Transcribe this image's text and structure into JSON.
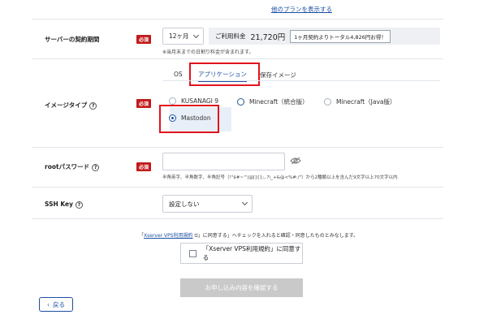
{
  "header": {
    "other_plans_link": "他のプランを表示する"
  },
  "contract": {
    "label": "サーバーの契約期間",
    "required": "必須",
    "period_value": "12ヶ月",
    "fee_label": "ご利用料金",
    "fee_value": "21,720円",
    "fee_note": "1ヶ月契約よりトータル4,826円お得！",
    "footnote": "※当月末までの日割り料金が含まれます。"
  },
  "image_type": {
    "label": "イメージタイプ",
    "required": "必須",
    "tabs": [
      "OS",
      "アプリケーション",
      "保存イメージ"
    ],
    "options": [
      "KUSANAGI 9",
      "Minecraft（統合版）",
      "Minecraft（Java版）",
      "Mastodon"
    ],
    "selected": "Mastodon"
  },
  "root_password": {
    "label": "rootパスワード",
    "required": "必須",
    "value": "",
    "note": "半角英字、半角数字、半角記号（!\"$#~^|@[]{};,.?\\_+&@<%#:/\"）から2種類以上を含んだ9文字以上70文字以内"
  },
  "ssh_key": {
    "label": "SSH Key",
    "value": "設定しない"
  },
  "terms": {
    "notice_pre": "「",
    "notice_link": "Xserver VPS利用規約",
    "notice_post": "」に同意する」へチェックを入れると確認・同意したものとみなします。",
    "checkbox_label": "「Xserver VPS利用規約」に同意する"
  },
  "actions": {
    "submit": "お申し込み内容を確認する",
    "back": "戻る"
  },
  "colors": {
    "accent": "#1a4fa3",
    "required": "#c21a1a",
    "highlight": "#e0141e"
  }
}
